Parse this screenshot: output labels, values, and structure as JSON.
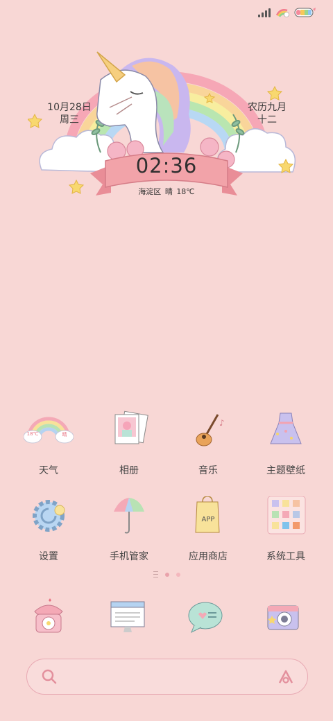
{
  "status": {
    "icons": [
      "signal-icon",
      "rainbow-cloud-icon",
      "battery-icon"
    ]
  },
  "widget": {
    "date": "10月28日",
    "weekday": "周三",
    "lunar_month": "农历九月",
    "lunar_day": "十二",
    "time": "02:36",
    "location": "海淀区",
    "weather": "晴",
    "temperature": "18℃",
    "weather_icon_temp": "18℃",
    "weather_icon_label": "晴"
  },
  "apps": [
    {
      "label": "天气",
      "icon": "rainbow-weather-icon"
    },
    {
      "label": "相册",
      "icon": "photo-album-icon"
    },
    {
      "label": "音乐",
      "icon": "guitar-icon"
    },
    {
      "label": "主题壁纸",
      "icon": "dress-icon"
    },
    {
      "label": "设置",
      "icon": "gear-icon"
    },
    {
      "label": "手机管家",
      "icon": "umbrella-icon"
    },
    {
      "label": "应用商店",
      "icon": "shopping-bag-icon"
    },
    {
      "label": "系统工具",
      "icon": "tools-folder-icon"
    }
  ],
  "app_store_bag_text": "APP",
  "dock": [
    {
      "icon": "phone-icon"
    },
    {
      "icon": "browser-icon"
    },
    {
      "icon": "message-icon"
    },
    {
      "icon": "camera-icon"
    }
  ],
  "pager": {
    "pages": 2,
    "current": 1
  },
  "search": {
    "icon_left": "search-icon",
    "icon_right": "assistant-icon"
  },
  "colors": {
    "background": "#f8d7d5",
    "accent": "#e9a2ab",
    "ribbon": "#f2a3a9"
  }
}
